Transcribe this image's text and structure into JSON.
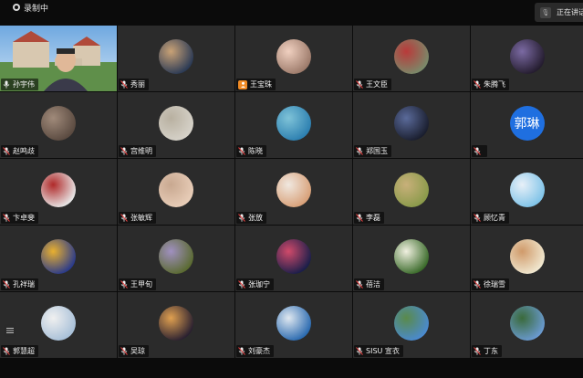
{
  "recording": {
    "label": "录制中"
  },
  "speaking": {
    "label": "正在讲话"
  },
  "participants": [
    {
      "name": "孙宇伟",
      "mic": "on",
      "avatar": "video"
    },
    {
      "name": "秀丽",
      "mic": "muted",
      "avatar": "photo",
      "colors": [
        "#2b3a55",
        "#c9a276"
      ]
    },
    {
      "name": "王宝珠",
      "mic": "host",
      "avatar": "photo",
      "colors": [
        "#9c7a6a",
        "#f0d0c0"
      ]
    },
    {
      "name": "王文臣",
      "mic": "muted",
      "avatar": "photo",
      "colors": [
        "#7a8a6a",
        "#b93a3a"
      ]
    },
    {
      "name": "朱腾飞",
      "mic": "muted",
      "avatar": "photo",
      "colors": [
        "#241c2e",
        "#7b6aa3"
      ]
    },
    {
      "name": "赵鸣歧",
      "mic": "muted",
      "avatar": "photo",
      "colors": [
        "#5a4a40",
        "#a08a7a"
      ]
    },
    {
      "name": "宫维明",
      "mic": "muted",
      "avatar": "photo",
      "colors": [
        "#d6d2c9",
        "#b8b0a0"
      ]
    },
    {
      "name": "陈晓",
      "mic": "muted",
      "avatar": "photo",
      "colors": [
        "#2c7fb0",
        "#7fc3d8"
      ]
    },
    {
      "name": "郑国玉",
      "mic": "muted",
      "avatar": "photo",
      "colors": [
        "#1a1e2e",
        "#5a6a9a"
      ]
    },
    {
      "name": "郭琳",
      "mic": "muted",
      "avatar": "text",
      "text": "郭琳",
      "colors": [
        "#1f6fe0",
        "#1f6fe0"
      ]
    },
    {
      "name": "卞卓斐",
      "mic": "muted",
      "avatar": "photo",
      "colors": [
        "#e8e8e8",
        "#b02a2a"
      ]
    },
    {
      "name": "张敏辉",
      "mic": "muted",
      "avatar": "photo",
      "colors": [
        "#e8cdb8",
        "#c8a890"
      ]
    },
    {
      "name": "张放",
      "mic": "muted",
      "avatar": "photo",
      "colors": [
        "#d8a078",
        "#f0e8e0"
      ]
    },
    {
      "name": "李磊",
      "mic": "muted",
      "avatar": "photo",
      "colors": [
        "#8a9a4a",
        "#c8b07a"
      ]
    },
    {
      "name": "顾忆青",
      "mic": "muted",
      "avatar": "photo",
      "colors": [
        "#7fc3e8",
        "#e8f0f8"
      ]
    },
    {
      "name": "孔祥瑞",
      "mic": "muted",
      "avatar": "photo",
      "colors": [
        "#2a3a8a",
        "#e8b030"
      ]
    },
    {
      "name": "王甲旬",
      "mic": "muted",
      "avatar": "photo",
      "colors": [
        "#5a6a30",
        "#a090c0"
      ]
    },
    {
      "name": "张珈宁",
      "mic": "muted",
      "avatar": "photo",
      "colors": [
        "#1a1e4a",
        "#d04a6a"
      ]
    },
    {
      "name": "蓓洁",
      "mic": "muted",
      "avatar": "photo",
      "colors": [
        "#3a6a2a",
        "#f0f0e0"
      ]
    },
    {
      "name": "徐瑞雪",
      "mic": "muted",
      "avatar": "photo",
      "colors": [
        "#f0e8d0",
        "#d09a6a"
      ]
    },
    {
      "name": "郭慧超",
      "mic": "muted",
      "avatar": "photo",
      "colors": [
        "#a8c0d8",
        "#f0f0f0"
      ]
    },
    {
      "name": "吴琼",
      "mic": "muted",
      "avatar": "photo",
      "colors": [
        "#2a2030",
        "#e0a050"
      ]
    },
    {
      "name": "刘豪杰",
      "mic": "muted",
      "avatar": "photo",
      "colors": [
        "#2a6ab0",
        "#e0e8f0"
      ]
    },
    {
      "name": "SISU 宣衣",
      "mic": "muted",
      "avatar": "photo",
      "colors": [
        "#4a8ad0",
        "#5a8a4a"
      ]
    },
    {
      "name": "丁东",
      "mic": "muted",
      "avatar": "photo",
      "colors": [
        "#6a9ad0",
        "#3a6a3a"
      ]
    }
  ]
}
